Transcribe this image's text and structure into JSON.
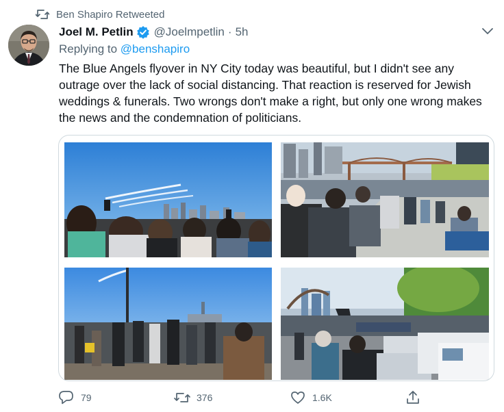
{
  "retweet_bar": {
    "text": "Ben Shapiro Retweeted"
  },
  "author": {
    "name": "Joel M. Petlin",
    "handle": "@Joelmpetlin",
    "separator": "·",
    "time": "5h"
  },
  "reply_context": {
    "prefix": "Replying to ",
    "mention": "@benshapiro"
  },
  "tweet": {
    "text": "The Blue Angels flyover in NY City today was beautiful, but I didn't see any outrage over the lack of social distancing. That reaction is reserved for Jewish weddings & funerals. Two wrongs don't make a right, but only one wrong makes the news and the condemnation of politicians."
  },
  "actions": {
    "replies": "79",
    "retweets": "376",
    "likes": "1.6K"
  },
  "colors": {
    "accent": "#1d9bf0",
    "secondary_text": "#536471",
    "border": "#cfd9de"
  },
  "icons": [
    "retweet-icon",
    "verified-icon",
    "chevron-down-icon",
    "reply-icon",
    "like-icon",
    "share-icon"
  ]
}
